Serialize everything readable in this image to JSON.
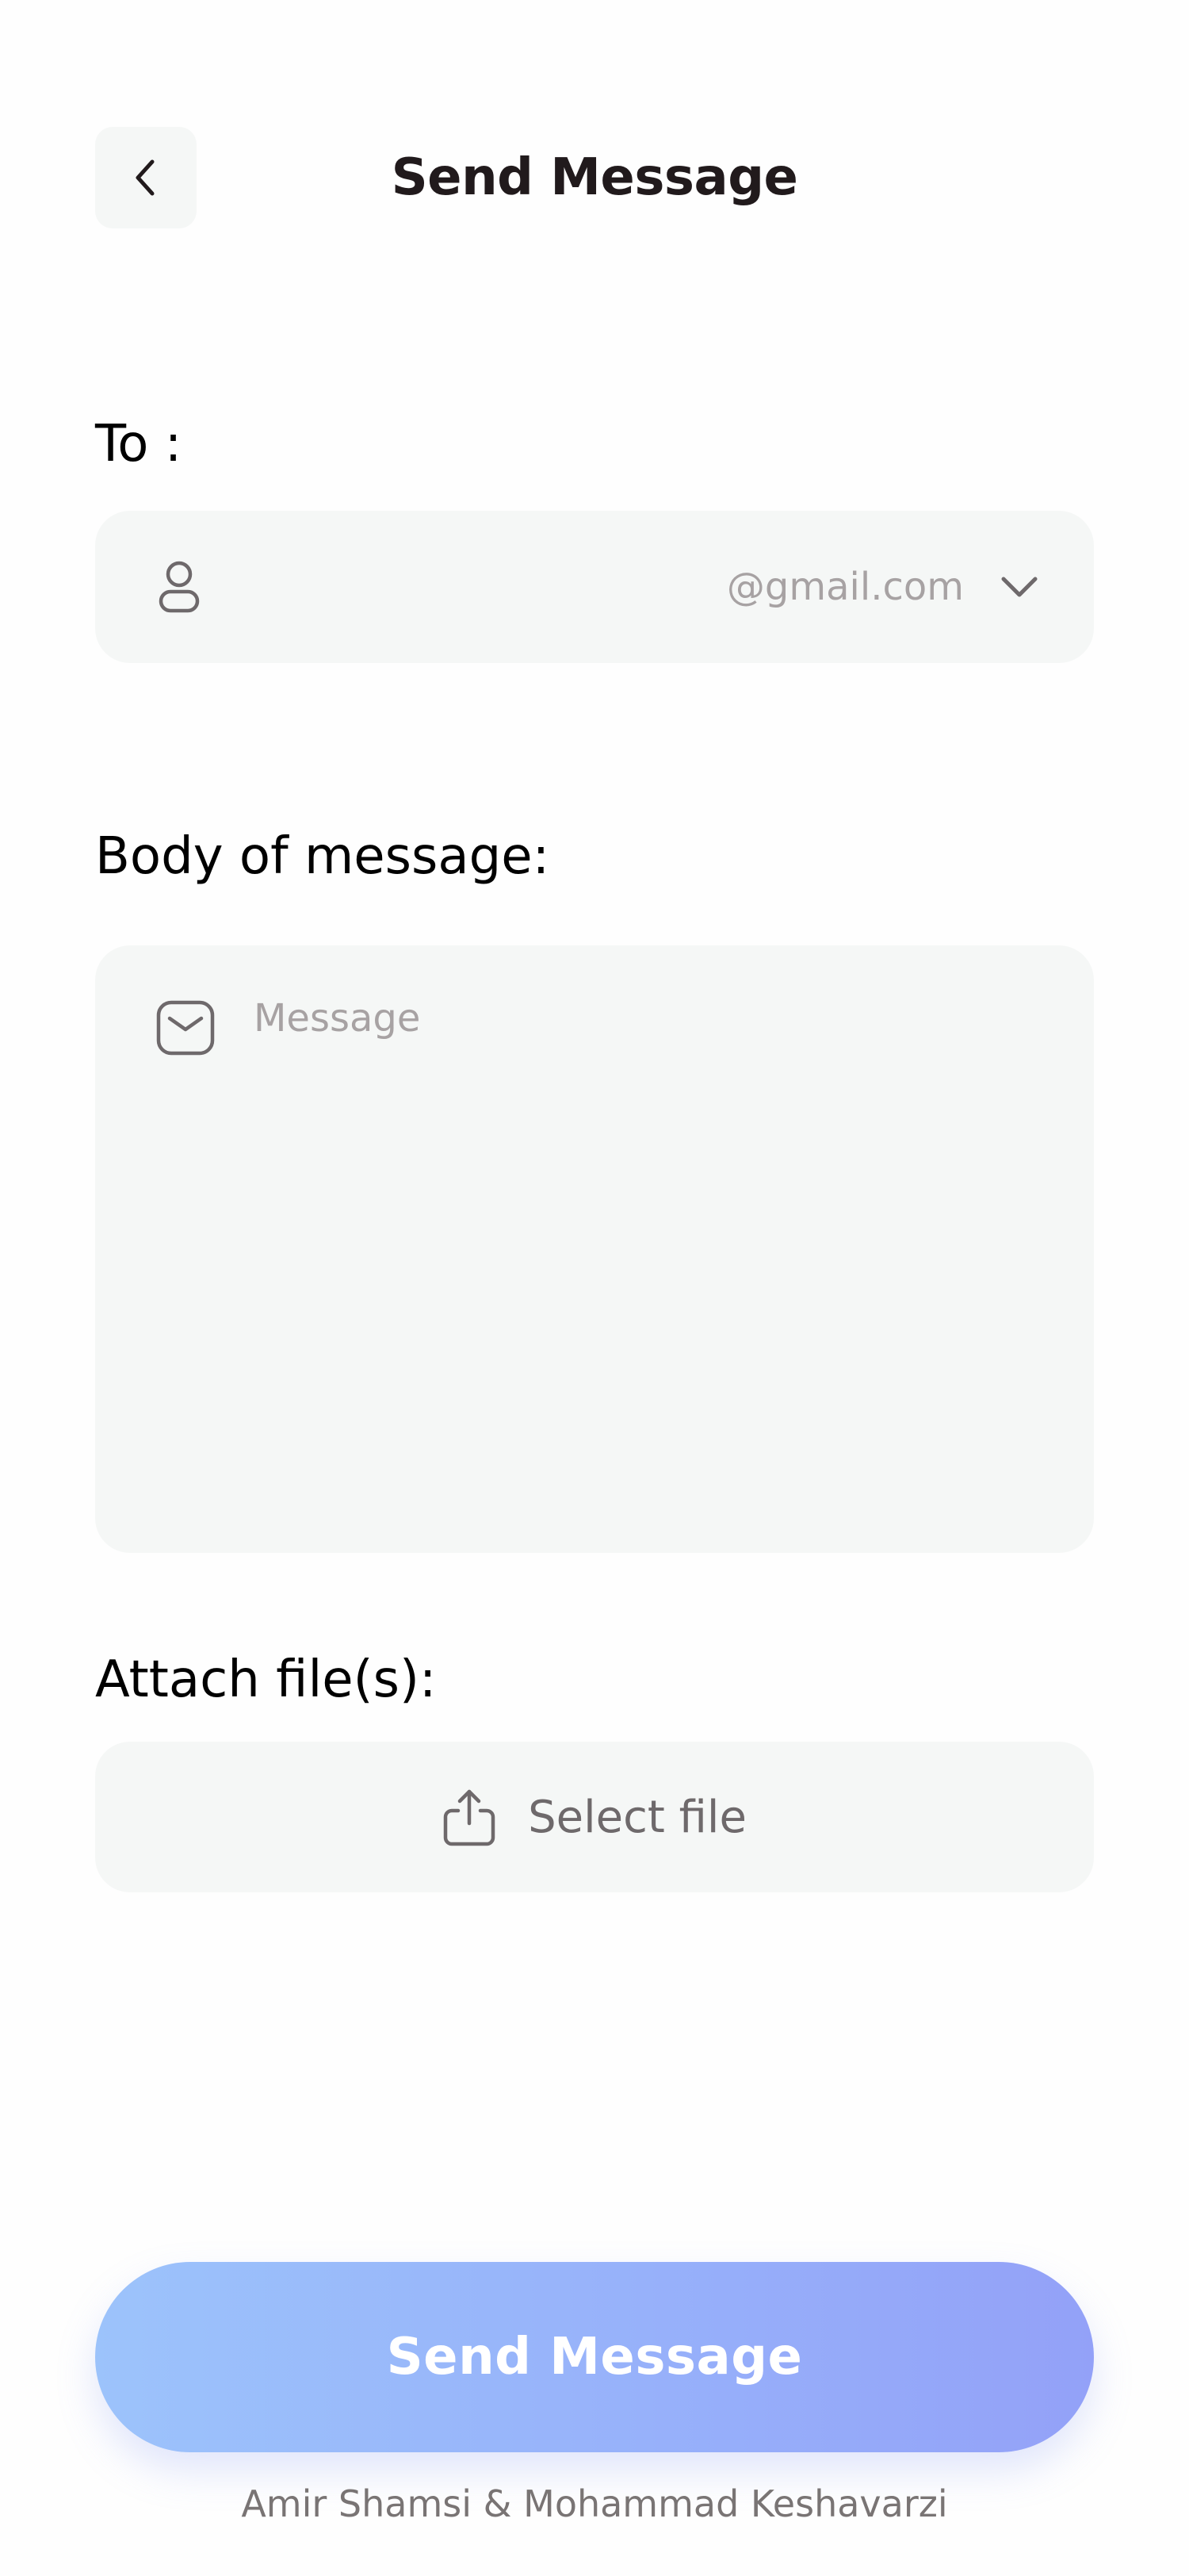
{
  "header": {
    "title": "Send Message",
    "back_icon": "chevron-left-icon"
  },
  "to_section": {
    "label": "To :",
    "icon": "user-icon",
    "value": "",
    "domain": "@gmail.com",
    "dropdown_icon": "chevron-down-icon"
  },
  "body_section": {
    "label": "Body of message:",
    "icon": "mail-icon",
    "placeholder": "Message",
    "value": ""
  },
  "attach_section": {
    "label": "Attach file(s):",
    "icon": "upload-icon",
    "button_label": "Select file"
  },
  "send_button": {
    "label": "Send Message"
  },
  "footer": {
    "credit": "Amir Shamsi & Mohammad Keshavarzi"
  },
  "colors": {
    "background": "#FEFEFE",
    "field_background": "#F5F7F6",
    "title_text": "#211A1C",
    "placeholder_text": "#A7A2A3",
    "button_gradient_start": "#9CC3FB",
    "button_gradient_end": "#93A1F8",
    "credit_text": "#797474"
  }
}
